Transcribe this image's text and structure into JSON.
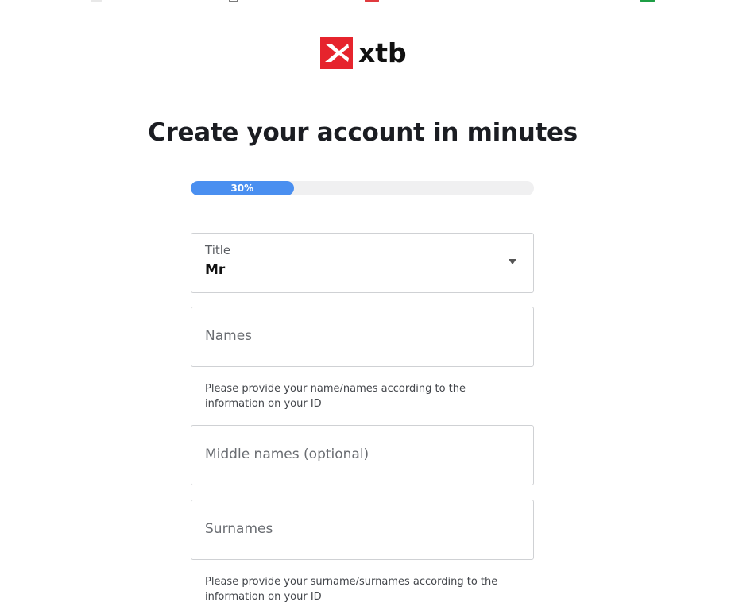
{
  "brand": {
    "name": "xtb",
    "logo_color": "#e6242d"
  },
  "heading": "Create your account in minutes",
  "progress": {
    "value": 0.3,
    "label": "30%",
    "color": "#4a8ff0"
  },
  "form": {
    "title": {
      "label": "Title",
      "value": "Mr"
    },
    "names": {
      "placeholder": "Names",
      "helper": "Please provide your name/names according to the information on your ID"
    },
    "middle_names": {
      "placeholder": "Middle names (optional)"
    },
    "surnames": {
      "placeholder": "Surnames",
      "helper": "Please provide your surname/surnames according to the information on your ID"
    }
  }
}
